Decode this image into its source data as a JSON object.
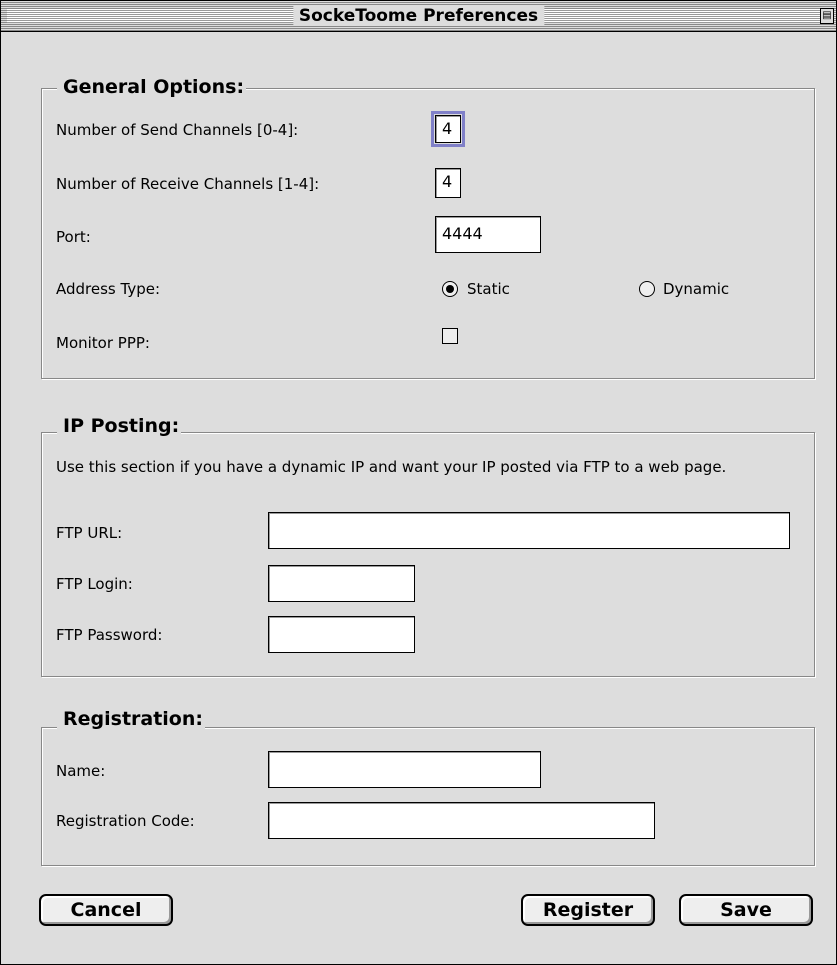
{
  "window": {
    "title": "SockeToome Preferences"
  },
  "general": {
    "legend": "General Options:",
    "send_channels_label": "Number of Send Channels [0-4]:",
    "send_channels_value": "4",
    "receive_channels_label": "Number of Receive Channels [1-4]:",
    "receive_channels_value": "4",
    "port_label": "Port:",
    "port_value": "4444",
    "address_type_label": "Address Type:",
    "address_static": "Static",
    "address_dynamic": "Dynamic",
    "address_selected": "Static",
    "monitor_ppp_label": "Monitor PPP:",
    "monitor_ppp_checked": false
  },
  "ip_posting": {
    "legend": "IP Posting:",
    "description": "Use this section if you have a dynamic IP and want your IP posted via FTP to a web page.",
    "ftp_url_label": "FTP URL:",
    "ftp_url_value": "",
    "ftp_login_label": "FTP Login:",
    "ftp_login_value": "",
    "ftp_password_label": "FTP Password:",
    "ftp_password_value": ""
  },
  "registration": {
    "legend": "Registration:",
    "name_label": "Name:",
    "name_value": "",
    "code_label": "Registration Code:",
    "code_value": ""
  },
  "buttons": {
    "cancel": "Cancel",
    "register": "Register",
    "save": "Save"
  }
}
